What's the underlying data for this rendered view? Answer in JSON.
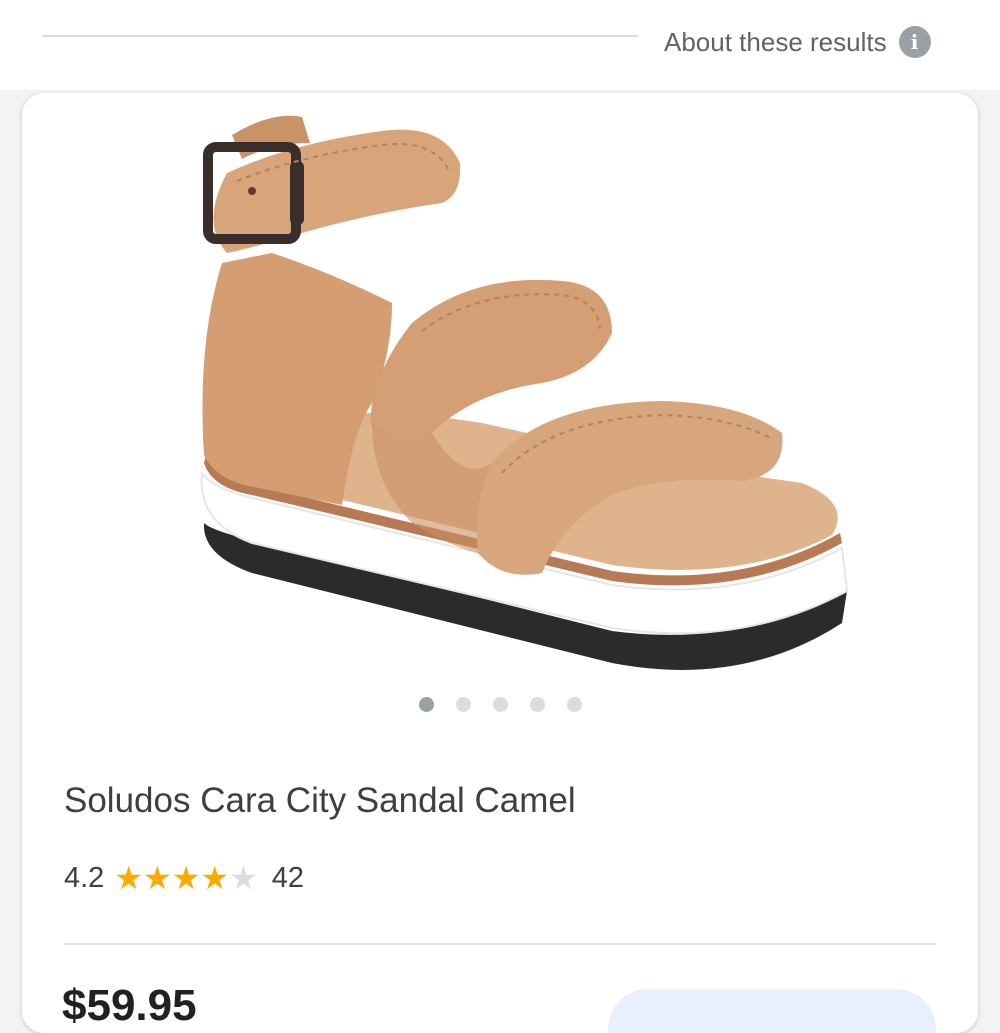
{
  "header": {
    "about_label": "About these results",
    "info_icon_glyph": "i"
  },
  "product": {
    "title": "Soludos Cara City Sandal Camel",
    "rating_value": "4.2",
    "rating_stars": 4.2,
    "rating_stars_max": 5,
    "review_count": "42",
    "price_partial": "$59.95",
    "image_slides_total": 5,
    "image_slide_active": 1
  },
  "colors": {
    "star_filled": "#f9ab00",
    "star_empty": "#dadce0",
    "sandal_leather": "#d6a57c",
    "sole_white": "#ffffff",
    "outsole": "#2b2b2b",
    "buckle": "#3a2e2a"
  },
  "icons": {
    "info": "info-circle-icon",
    "star": "star-icon"
  }
}
